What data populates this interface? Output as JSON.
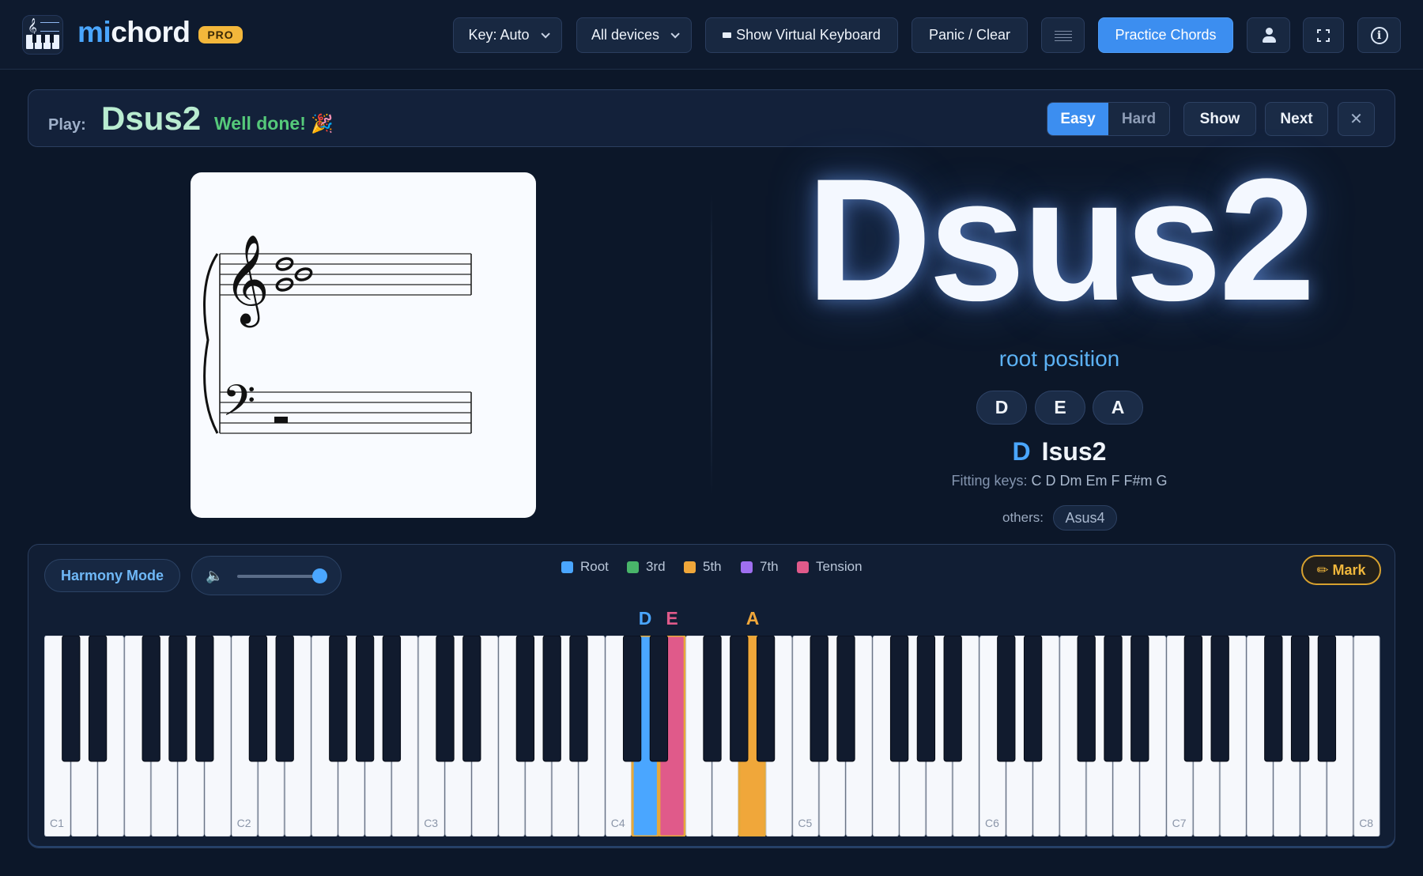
{
  "app": {
    "brand_prefix": "mi",
    "brand_suffix": "chord",
    "badge": "PRO"
  },
  "toolbar": {
    "key_select": "Key: Auto",
    "device_select": "All devices",
    "virtual_keyboard": "Show Virtual Keyboard",
    "panic": "Panic / Clear",
    "practice": "Practice Chords"
  },
  "challenge": {
    "play_label": "Play:",
    "chord": "Dsus2",
    "feedback": "Well done! 🎉",
    "easy": "Easy",
    "hard": "Hard",
    "show": "Show",
    "next": "Next",
    "close": "✕",
    "difficulty_selected": "Easy"
  },
  "chord": {
    "name": "Dsus2",
    "inversion": "root position",
    "notes": [
      "D",
      "E",
      "A"
    ],
    "alt_root": "D",
    "alt_quality": "Isus2",
    "fitting_label": "Fitting keys:",
    "fitting_keys": "C D Dm Em F F#m G",
    "others_label": "others:",
    "others": [
      "Asus4"
    ]
  },
  "keyboard_panel": {
    "harmony_mode": "Harmony Mode",
    "volume": 0.9,
    "legend": [
      {
        "label": "Root",
        "color": "#4aa6ff"
      },
      {
        "label": "3rd",
        "color": "#49b56a"
      },
      {
        "label": "5th",
        "color": "#f0a73a"
      },
      {
        "label": "7th",
        "color": "#9f6ff0"
      },
      {
        "label": "Tension",
        "color": "#e05a8a"
      }
    ],
    "mark": "✏ Mark",
    "octave_labels": [
      "C1",
      "C2",
      "C3",
      "C4",
      "C5",
      "C6",
      "C7",
      "C8"
    ],
    "active_notes": [
      {
        "note": "D",
        "octave": 4,
        "role": "root",
        "color": "#4aa6ff"
      },
      {
        "note": "E",
        "octave": 4,
        "role": "tension",
        "color": "#e05a8a"
      },
      {
        "note": "A",
        "octave": 4,
        "role": "5th",
        "color": "#f0a73a"
      }
    ]
  },
  "colors": {
    "background": "#0c1729",
    "accent": "#3c8ef0",
    "success": "#55c97a",
    "highlight_border": "#e7a93a"
  }
}
